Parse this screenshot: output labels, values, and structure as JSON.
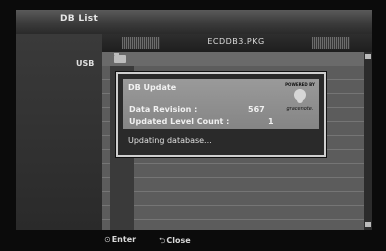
{
  "window": {
    "title": "DB List"
  },
  "sidebar": {
    "source": "USB"
  },
  "file_bar": {
    "file_name": "ECDDB3.PKG"
  },
  "dialog": {
    "title": "DB Update",
    "logo": {
      "powered_by": "POWERED BY",
      "brand": "gracenote."
    },
    "fields": [
      {
        "label": "Data Revision :",
        "value": "567"
      },
      {
        "label": "Updated Level Count :",
        "value": "1"
      }
    ],
    "status": "Updating database..."
  },
  "footer": {
    "enter_symbol": "⊙",
    "enter_label": "Enter",
    "close_symbol": "⮌",
    "close_label": "Close"
  }
}
